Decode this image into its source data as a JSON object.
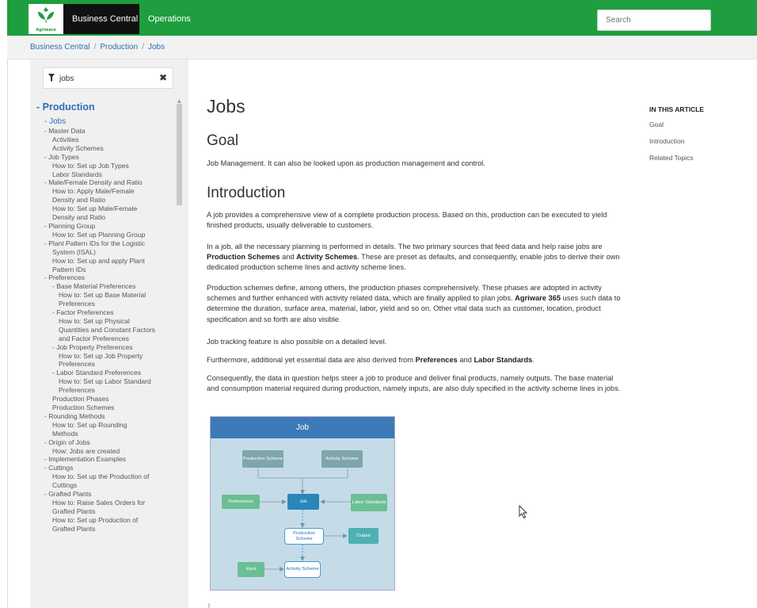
{
  "header": {
    "logo_text": "Agriware",
    "brand": "Business Central",
    "operations": "Operations",
    "search_placeholder": "Search",
    "accent": "#1e9e3e"
  },
  "breadcrumb": {
    "items": [
      "Business Central",
      "Production",
      "Jobs"
    ],
    "separator": "/"
  },
  "sidebar": {
    "filter_value": "jobs",
    "clear_icon": "close-icon",
    "toc": [
      {
        "label": "- Production",
        "level": 0
      },
      {
        "label": "- Jobs",
        "level": "1a"
      },
      {
        "label": "- Master Data",
        "level": 1
      },
      {
        "label": "Activities",
        "level": 2
      },
      {
        "label": "Activity Schemes",
        "level": 2
      },
      {
        "label": "- Job Types",
        "level": 1
      },
      {
        "label": "How to: Set up Job Types",
        "level": 2
      },
      {
        "label": "Labor Standards",
        "level": 2
      },
      {
        "label": "- Male/Female Density and Ratio",
        "level": 1
      },
      {
        "label": "How to: Apply Male/Female",
        "level": 2
      },
      {
        "label": "Density and Ratio",
        "level": 2
      },
      {
        "label": "How to: Set up Male/Female",
        "level": 2
      },
      {
        "label": "Density and Ratio",
        "level": 2
      },
      {
        "label": "- Planning Group",
        "level": 1
      },
      {
        "label": "How to: Set up Planning Group",
        "level": 2
      },
      {
        "label": "- Plant Pattern IDs for the Logistic",
        "level": 1
      },
      {
        "label": "System (ISAL)",
        "level": 2
      },
      {
        "label": "How to: Set up and apply Plant",
        "level": 2
      },
      {
        "label": "Pattern IDs",
        "level": 2
      },
      {
        "label": "- Preferences",
        "level": 1
      },
      {
        "label": "- Base Material Preferences",
        "level": 2
      },
      {
        "label": "How to: Set up Base Material",
        "level": 3
      },
      {
        "label": "Preferences",
        "level": 3
      },
      {
        "label": "- Factor Preferences",
        "level": 2
      },
      {
        "label": "How to: Set up Physical",
        "level": 3
      },
      {
        "label": "Quantities and Constant Factors",
        "level": 3
      },
      {
        "label": "and Factor Preferences",
        "level": 3
      },
      {
        "label": "- Job Property Preferences",
        "level": 2
      },
      {
        "label": "How to: Set up Job Property",
        "level": 3
      },
      {
        "label": "Preferences",
        "level": 3
      },
      {
        "label": "- Labor Standard Preferences",
        "level": 2
      },
      {
        "label": "How to: Set up Labor Standard",
        "level": 3
      },
      {
        "label": "Preferences",
        "level": 3
      },
      {
        "label": "Production Phases",
        "level": 2
      },
      {
        "label": "Production Schemes",
        "level": 2
      },
      {
        "label": "- Rounding Methods",
        "level": 1
      },
      {
        "label": "How to: Set up Rounding",
        "level": 2
      },
      {
        "label": "Methods",
        "level": 2
      },
      {
        "label": "- Origin of Jobs",
        "level": 1
      },
      {
        "label": "How: Jobs are created",
        "level": 2
      },
      {
        "label": "- Implementation Examples",
        "level": 1
      },
      {
        "label": "- Cuttings",
        "level": 1
      },
      {
        "label": "How to: Set up the Production of",
        "level": 2
      },
      {
        "label": "Cuttings",
        "level": 2
      },
      {
        "label": "- Grafted Plants",
        "level": 1
      },
      {
        "label": "How to: Raise Sales Orders for",
        "level": 2
      },
      {
        "label": "Grafted Plants",
        "level": 2
      },
      {
        "label": "How to: Set up Production of",
        "level": 2
      },
      {
        "label": "Grafted Plants",
        "level": 2
      }
    ]
  },
  "main": {
    "title": "Jobs",
    "goal_heading": "Goal",
    "goal_text": "Job Management. It can also be looked upon as production management and control.",
    "intro_heading": "Introduction",
    "p1": "A job provides a comprehensive view of a complete production process. Based on this, production can be executed to yield finished products, usually deliverable to customers.",
    "p2": {
      "a": "In a job, all the necessary planning is performed in details. The two primary sources that feed data and help raise jobs are ",
      "b": "Production Schemes",
      "c": " and ",
      "d": "Activity Schemes",
      "e": ". These are preset as defaults, and consequently, enable jobs to derive their own dedicated production scheme lines and activity scheme lines."
    },
    "p3": {
      "a": "Production schemes define, among others, the production phases comprehensively. These phases are adopted in activity schemes and further enhanced with activity related data, which are finally applied to plan jobs. ",
      "b": "Agriware 365",
      "c": " uses such data to determine the duration, surface area, material, labor, yield and so on. Other vital data such as customer, location, product specification and so forth are also visible."
    },
    "p4": "Job tracking feature is also possible on a detailed level.",
    "p5": {
      "a": "Furthermore, additional yet essential data are also derived from ",
      "b": "Preferences",
      "c": " and ",
      "d": "Labor Standards",
      "e": "."
    },
    "p6": "Consequently, the data in question helps steer a job to produce and deliver final products, namely outputs. The base material and consumption material required during production, namely inputs, are also duly specified in the activity scheme lines in jobs."
  },
  "diagram": {
    "title": "Job",
    "production_scheme": "Production Scheme",
    "activity_scheme": "Activity Scheme",
    "preferences": "Preferences",
    "job": "Job",
    "labor_standards": "Labor Standards",
    "production_scheme_2": "Production Scheme",
    "output": "Output",
    "input": "Input",
    "activity_scheme_2": "Activity Scheme"
  },
  "article_nav": {
    "header": "IN THIS ARTICLE",
    "links": [
      "Goal",
      "Introduction",
      "Related Topics"
    ]
  }
}
